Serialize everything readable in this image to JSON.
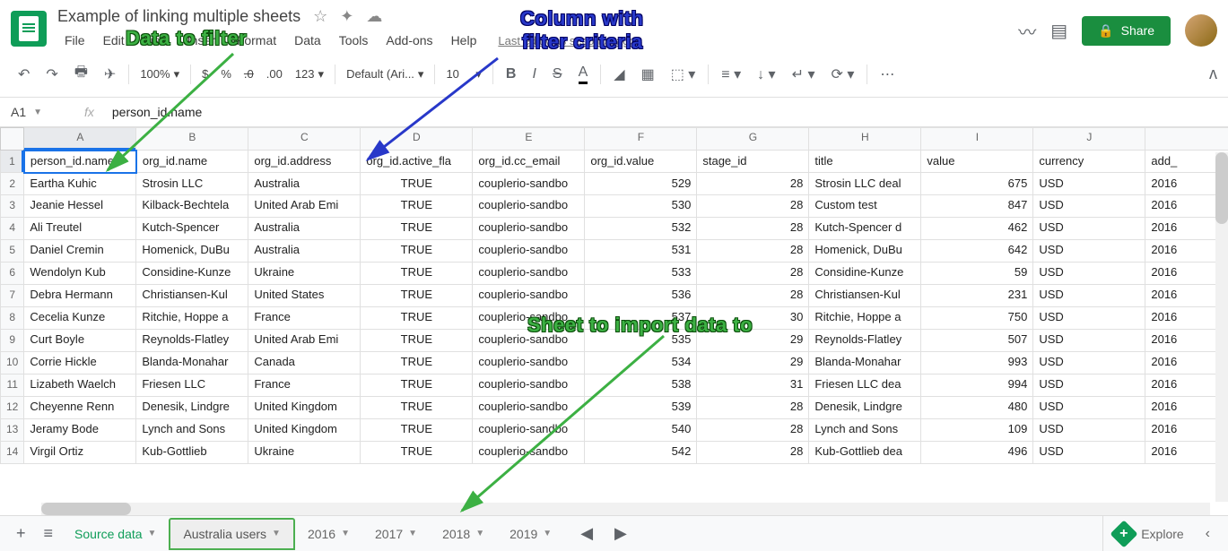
{
  "doc_title": "Example of linking multiple sheets",
  "menu": [
    "File",
    "Edit",
    "View",
    "Insert",
    "Format",
    "Data",
    "Tools",
    "Add-ons",
    "Help"
  ],
  "last_edit": "Last edit was seconds ago",
  "share_label": "Share",
  "toolbar": {
    "zoom": "100%",
    "currency": "$",
    "percent": "%",
    "dec_dec": ".0",
    "inc_dec": ".00",
    "format_num": "123",
    "font": "Default (Ari...",
    "font_size": "10"
  },
  "cell_ref": "A1",
  "formula_value": "person_id.name",
  "col_labels": [
    "A",
    "B",
    "C",
    "D",
    "E",
    "F",
    "G",
    "H",
    "I",
    "J",
    ""
  ],
  "headers": [
    "person_id.name",
    "org_id.name",
    "org_id.address",
    "org_id.active_fla",
    "org_id.cc_email",
    "org_id.value",
    "stage_id",
    "title",
    "value",
    "currency",
    "add_"
  ],
  "rows": [
    [
      "Eartha Kuhic",
      "Strosin LLC",
      "Australia",
      "TRUE",
      "couplerio-sandbo",
      "529",
      "28",
      "Strosin LLC deal",
      "675",
      "USD",
      "2016"
    ],
    [
      "Jeanie Hessel",
      "Kilback-Bechtela",
      "United Arab Emi",
      "TRUE",
      "couplerio-sandbo",
      "530",
      "28",
      "Custom test",
      "847",
      "USD",
      "2016"
    ],
    [
      "Ali Treutel",
      "Kutch-Spencer",
      "Australia",
      "TRUE",
      "couplerio-sandbo",
      "532",
      "28",
      "Kutch-Spencer d",
      "462",
      "USD",
      "2016"
    ],
    [
      "Daniel Cremin",
      "Homenick, DuBu",
      "Australia",
      "TRUE",
      "couplerio-sandbo",
      "531",
      "28",
      "Homenick, DuBu",
      "642",
      "USD",
      "2016"
    ],
    [
      "Wendolyn Kub",
      "Considine-Kunze",
      "Ukraine",
      "TRUE",
      "couplerio-sandbo",
      "533",
      "28",
      "Considine-Kunze",
      "59",
      "USD",
      "2016"
    ],
    [
      "Debra Hermann",
      "Christiansen-Kul",
      "United States",
      "TRUE",
      "couplerio-sandbo",
      "536",
      "28",
      "Christiansen-Kul",
      "231",
      "USD",
      "2016"
    ],
    [
      "Cecelia Kunze",
      "Ritchie, Hoppe a",
      "France",
      "TRUE",
      "couplerio-sandbo",
      "537",
      "30",
      "Ritchie, Hoppe a",
      "750",
      "USD",
      "2016"
    ],
    [
      "Curt Boyle",
      "Reynolds-Flatley",
      "United Arab Emi",
      "TRUE",
      "couplerio-sandbo",
      "535",
      "29",
      "Reynolds-Flatley",
      "507",
      "USD",
      "2016"
    ],
    [
      "Corrie Hickle",
      "Blanda-Monahar",
      "Canada",
      "TRUE",
      "couplerio-sandbo",
      "534",
      "29",
      "Blanda-Monahar",
      "993",
      "USD",
      "2016"
    ],
    [
      "Lizabeth Waelch",
      "Friesen LLC",
      "France",
      "TRUE",
      "couplerio-sandbo",
      "538",
      "31",
      "Friesen LLC dea",
      "994",
      "USD",
      "2016"
    ],
    [
      "Cheyenne Renn",
      "Denesik, Lindgre",
      "United Kingdom",
      "TRUE",
      "couplerio-sandbo",
      "539",
      "28",
      "Denesik, Lindgre",
      "480",
      "USD",
      "2016"
    ],
    [
      "Jeramy Bode",
      "Lynch and Sons",
      "United Kingdom",
      "TRUE",
      "couplerio-sandbo",
      "540",
      "28",
      "Lynch and Sons",
      "109",
      "USD",
      "2016"
    ],
    [
      "Virgil Ortiz",
      "Kub-Gottlieb",
      "Ukraine",
      "TRUE",
      "couplerio-sandbo",
      "542",
      "28",
      "Kub-Gottlieb dea",
      "496",
      "USD",
      "2016"
    ]
  ],
  "numeric_cols": [
    5,
    6,
    8
  ],
  "center_cols": [
    3
  ],
  "sheet_tabs": [
    {
      "label": "Source data",
      "active": true
    },
    {
      "label": "Australia users",
      "highlighted": true
    },
    {
      "label": "2016"
    },
    {
      "label": "2017"
    },
    {
      "label": "2018"
    },
    {
      "label": "2019"
    }
  ],
  "explore_label": "Explore",
  "annotations": {
    "a1": "Data to filter",
    "a2": "Column with",
    "a2b": "filter criteria",
    "a3": "Sheet to import data to"
  }
}
